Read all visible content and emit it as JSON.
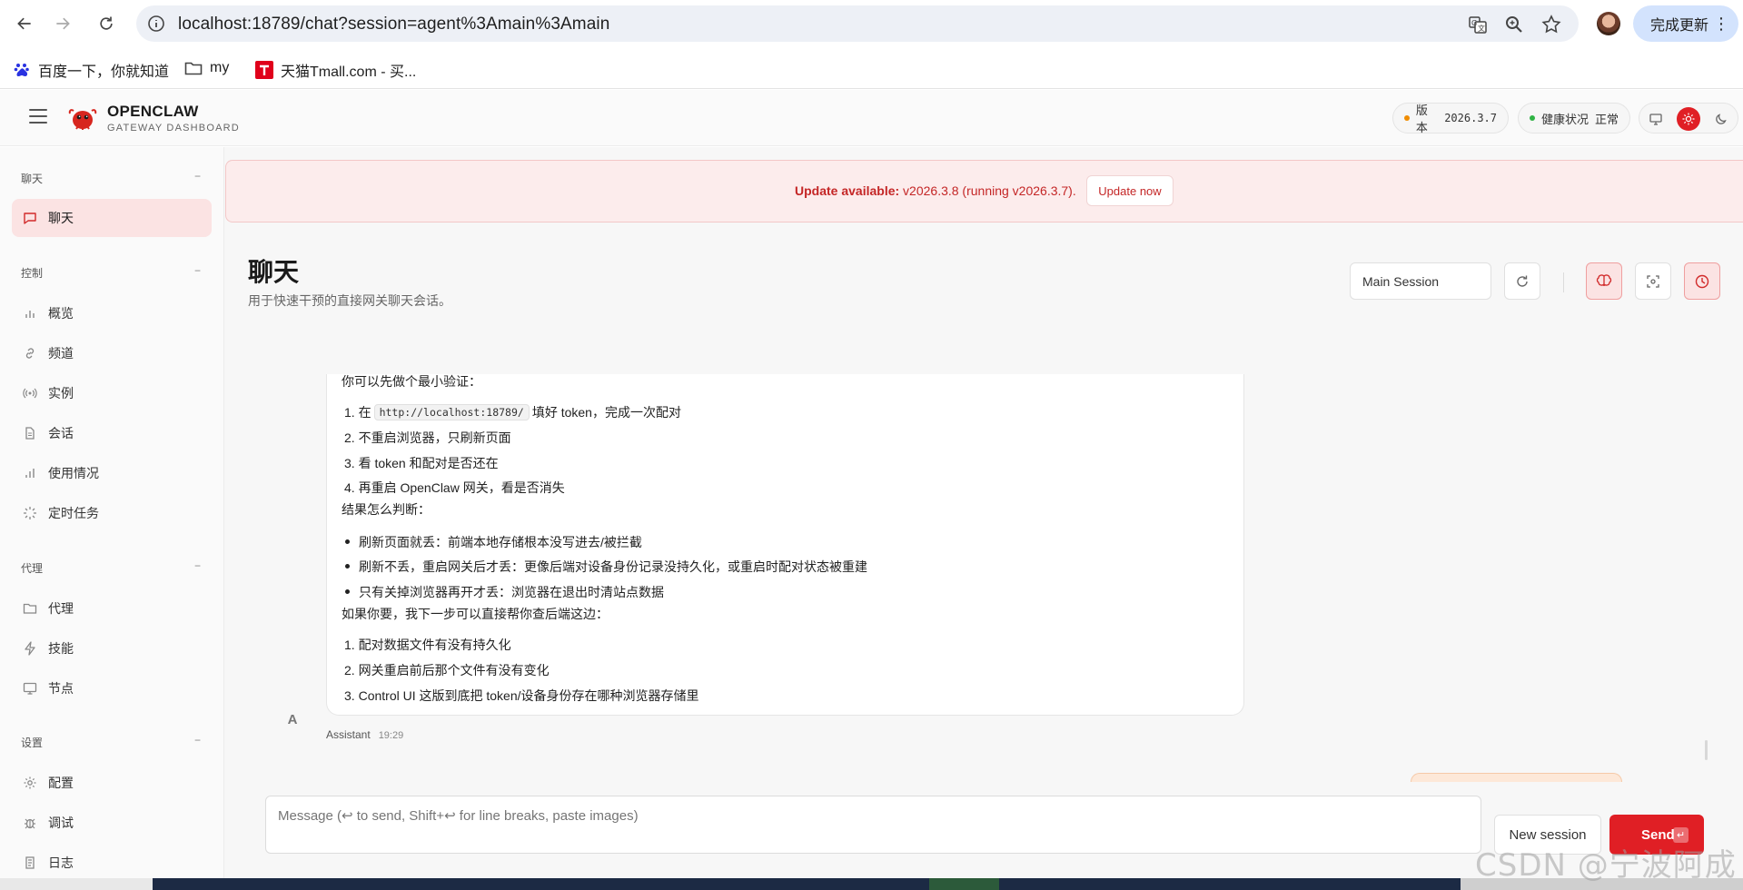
{
  "browser": {
    "url": "localhost:18789/chat?session=agent%3Amain%3Amain",
    "update_button": "完成更新",
    "bookmarks": [
      {
        "label": "百度一下，你就知道",
        "icon": "baidu-icon"
      },
      {
        "label": "my",
        "icon": "folder-icon"
      },
      {
        "label": "天猫Tmall.com - 买...",
        "icon": "tmall-icon"
      }
    ]
  },
  "app": {
    "brand_name": "OPENCLAW",
    "brand_sub": "GATEWAY DASHBOARD",
    "version_label": "版本",
    "version_value": "2026.3.7",
    "health_label": "健康状况",
    "health_value": "正常",
    "colors": {
      "accent": "#e01f25",
      "version_dot": "#f08c00",
      "health_dot": "#2fb344"
    }
  },
  "sidebar": {
    "sections": [
      {
        "title": "聊天",
        "toggle": "−",
        "items": [
          {
            "label": "聊天",
            "icon": "chat-icon",
            "active": true
          }
        ]
      },
      {
        "title": "控制",
        "toggle": "−",
        "items": [
          {
            "label": "概览",
            "icon": "bar-chart-icon"
          },
          {
            "label": "频道",
            "icon": "link-icon"
          },
          {
            "label": "实例",
            "icon": "broadcast-icon"
          },
          {
            "label": "会话",
            "icon": "file-icon"
          },
          {
            "label": "使用情况",
            "icon": "usage-chart-icon"
          },
          {
            "label": "定时任务",
            "icon": "loader-icon"
          }
        ]
      },
      {
        "title": "代理",
        "toggle": "−",
        "items": [
          {
            "label": "代理",
            "icon": "folder-icon"
          },
          {
            "label": "技能",
            "icon": "zap-icon"
          },
          {
            "label": "节点",
            "icon": "monitor-icon"
          }
        ]
      },
      {
        "title": "设置",
        "toggle": "−",
        "items": [
          {
            "label": "配置",
            "icon": "settings-icon"
          },
          {
            "label": "调试",
            "icon": "bug-icon"
          },
          {
            "label": "日志",
            "icon": "scroll-icon"
          }
        ]
      }
    ]
  },
  "banner": {
    "strong": "Update available:",
    "text": " v2026.3.8 (running v2026.3.7).",
    "button": "Update now"
  },
  "page": {
    "title": "聊天",
    "subtitle": "用于快速干预的直接网关聊天会话。",
    "session_select": "Main Session"
  },
  "message": {
    "lead": "你可以先做个最小验证：",
    "steps": [
      {
        "num": "1.",
        "pre": "在",
        "code": "http://localhost:18789/",
        "post": "填好 token，完成一次配对"
      },
      {
        "num": "2.",
        "text": "不重启浏览器，只刷新页面"
      },
      {
        "num": "3.",
        "text": "看 token 和配对是否还在"
      },
      {
        "num": "4.",
        "text": "再重启 OpenClaw 网关，看是否消失"
      }
    ],
    "judge_title": "结果怎么判断：",
    "bullets": [
      "刷新页面就丢：前端本地存储根本没写进去/被拦截",
      "刷新不丢，重启网关后才丢：更像后端对设备身份记录没持久化，或重启时配对状态被重建",
      "只有关掉浏览器再开才丢：浏览器在退出时清站点数据"
    ],
    "next_title": "如果你要，我下一步可以直接帮你查后端这边：",
    "next_steps": [
      {
        "num": "1.",
        "text": "配对数据文件有没有持久化"
      },
      {
        "num": "2.",
        "text": "网关重启前后那个文件有没有变化"
      },
      {
        "num": "3.",
        "text": "Control UI 这版到底把 token/设备身份存在哪种浏览器存储里"
      }
    ],
    "avatar": "A",
    "sender": "Assistant",
    "time": "19:29"
  },
  "composer": {
    "placeholder": "Message (↩ to send, Shift+↩ for line breaks, paste images)",
    "new_session": "New session",
    "send": "Send",
    "send_key": "↵"
  },
  "watermark": "CSDN @宁波阿成"
}
